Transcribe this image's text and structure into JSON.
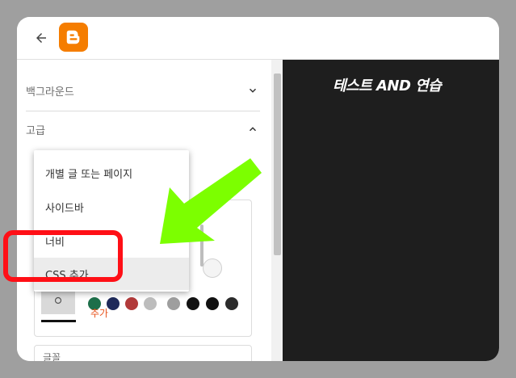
{
  "sidebar": {
    "sections": [
      {
        "label": "백그라운드",
        "expanded": false
      },
      {
        "label": "고급",
        "expanded": true
      }
    ],
    "add_label": "추가",
    "font_label": "글꼴",
    "swatch_colors": [
      "#1e6f4a",
      "#1f2a5a",
      "#b23a3a",
      "#bdbdbd",
      "#9e9e9e",
      "#111111",
      "#111111",
      "#2b2b2b"
    ]
  },
  "dropdown": {
    "items": [
      {
        "label": "개별 글 또는 페이지"
      },
      {
        "label": "사이드바"
      },
      {
        "label": "너비"
      },
      {
        "label": "CSS 추가",
        "active": true
      }
    ]
  },
  "preview": {
    "title": "테스트 AND 연습"
  },
  "colors": {
    "brand": "#f57d00",
    "annotation_red": "#ff0f16",
    "annotation_green": "#7cff00",
    "preview_bg": "#1e1e1e"
  },
  "icons": {
    "back": "back-arrow-icon",
    "logo": "blogger-logo-icon",
    "chevron_down": "chevron-down-icon",
    "chevron_up": "chevron-up-icon"
  }
}
